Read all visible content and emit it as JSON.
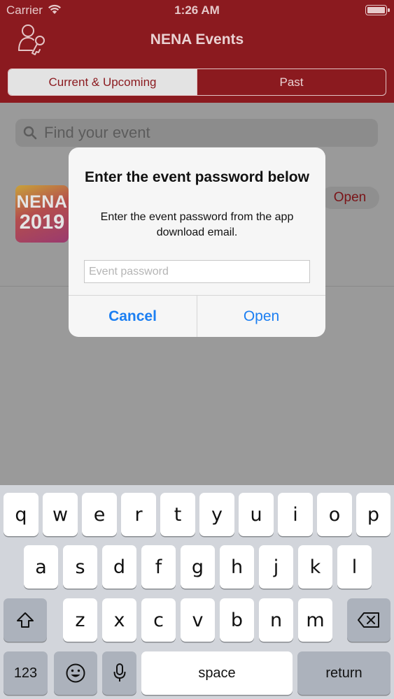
{
  "status_bar": {
    "carrier": "Carrier",
    "time": "1:26 AM"
  },
  "header": {
    "title": "NENA Events"
  },
  "tabs": [
    {
      "label": "Current & Upcoming",
      "active": true
    },
    {
      "label": "Past",
      "active": false
    }
  ],
  "search": {
    "placeholder": "Find your event"
  },
  "event": {
    "logo_line1": "NENA",
    "logo_line2": "2019",
    "open_label": "Open"
  },
  "alert": {
    "title": "Enter the event password below",
    "message": "Enter the event password from the app download email.",
    "input_placeholder": "Event password",
    "input_value": "",
    "cancel_label": "Cancel",
    "open_label": "Open"
  },
  "keyboard": {
    "row1": [
      "q",
      "w",
      "e",
      "r",
      "t",
      "y",
      "u",
      "i",
      "o",
      "p"
    ],
    "row2": [
      "a",
      "s",
      "d",
      "f",
      "g",
      "h",
      "j",
      "k",
      "l"
    ],
    "row3": [
      "z",
      "x",
      "c",
      "v",
      "b",
      "n",
      "m"
    ],
    "numbers_label": "123",
    "space_label": "space",
    "return_label": "return"
  },
  "colors": {
    "brand": "#8b1a1f",
    "link": "#1c7ff2"
  }
}
